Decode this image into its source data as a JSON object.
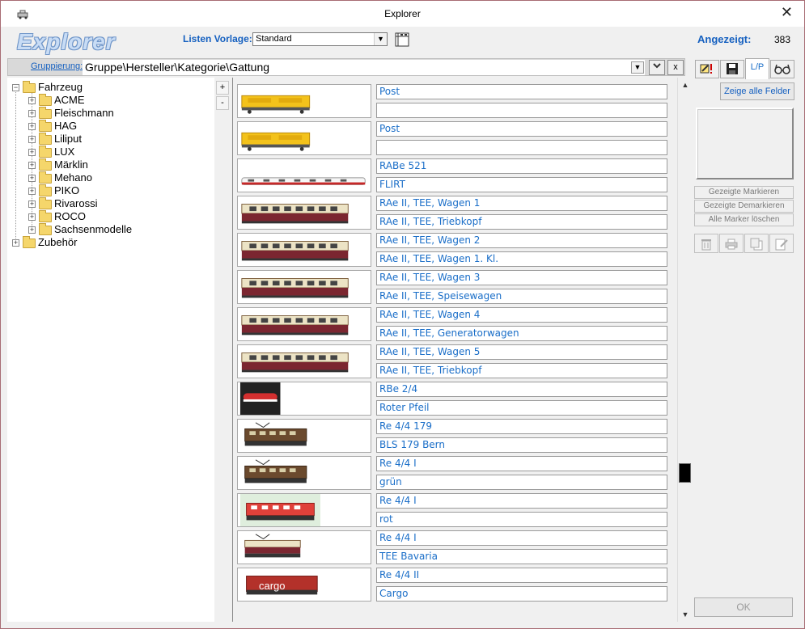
{
  "window": {
    "title": "Explorer",
    "close": "✕"
  },
  "header": {
    "logo": "Explorer",
    "listen_vorlage_label": "Listen Vorlage:",
    "listen_vorlage_value": "Standard",
    "angezeigt_label": "Angezeigt:",
    "angezeigt_count": "383"
  },
  "grouping": {
    "label": "Gruppierung:",
    "value": "Gruppe\\Hersteller\\Kategorie\\Gattung",
    "clear": "x"
  },
  "tree": {
    "root": "Fahrzeug",
    "children": [
      "ACME",
      "Fleischmann",
      "HAG",
      "Liliput",
      "LUX",
      "Märklin",
      "Mehano",
      "PIKO",
      "Rivarossi",
      "ROCO",
      "Sachsenmodelle"
    ],
    "sibling": "Zubehör",
    "expand_plus": "+",
    "collapse_minus": "-"
  },
  "list": {
    "items": [
      {
        "line1": "Post",
        "line2": "",
        "thumb": "yellow-wagon"
      },
      {
        "line1": "Post",
        "line2": "",
        "thumb": "yellow-wagon"
      },
      {
        "line1": "RABe 521",
        "line2": "FLIRT",
        "thumb": "flirt-train"
      },
      {
        "line1": "RAe II, TEE, Wagen 1",
        "line2": "RAe II, TEE, Triebkopf",
        "thumb": "tee-cream"
      },
      {
        "line1": "RAe II, TEE, Wagen 2",
        "line2": "RAe II, TEE, Wagen 1. Kl.",
        "thumb": "tee-cream"
      },
      {
        "line1": "RAe II, TEE, Wagen 3",
        "line2": "RAe II, TEE, Speisewagen",
        "thumb": "tee-cream"
      },
      {
        "line1": "RAe II, TEE, Wagen 4",
        "line2": "RAe II, TEE, Generatorwagen",
        "thumb": "tee-cream"
      },
      {
        "line1": "RAe II, TEE, Wagen 5",
        "line2": "RAe II, TEE, Triebkopf",
        "thumb": "tee-cream"
      },
      {
        "line1": "RBe 2/4",
        "line2": "Roter Pfeil",
        "thumb": "red-arrow"
      },
      {
        "line1": "Re 4/4 179",
        "line2": "BLS 179 Bern",
        "thumb": "brown-loco"
      },
      {
        "line1": "Re 4/4 I",
        "line2": "grün",
        "thumb": "brown-loco"
      },
      {
        "line1": "Re 4/4 I",
        "line2": "rot",
        "thumb": "red-loco"
      },
      {
        "line1": "Re 4/4 I",
        "line2": "TEE Bavaria",
        "thumb": "tee-loco"
      },
      {
        "line1": "Re 4/4 II",
        "line2": "Cargo",
        "thumb": "cargo-loco",
        "thumb_text": "cargo"
      }
    ]
  },
  "right_panel": {
    "tab_icons": [
      "edit-warning-icon",
      "save-icon",
      "lp-tab",
      "glasses-icon"
    ],
    "tab_lp_label": "L/P",
    "zeige_alle_felder": "Zeige alle Felder",
    "gezeigte_markieren": "Gezeigte Markieren",
    "gezeigte_demarkieren": "Gezeigte Demarkieren",
    "alle_marker_loeschen": "Alle Marker löschen",
    "ok": "OK"
  },
  "colors": {
    "accent": "#1560c0",
    "field_text": "#1a6ec8",
    "folder": "#f5d66b"
  }
}
